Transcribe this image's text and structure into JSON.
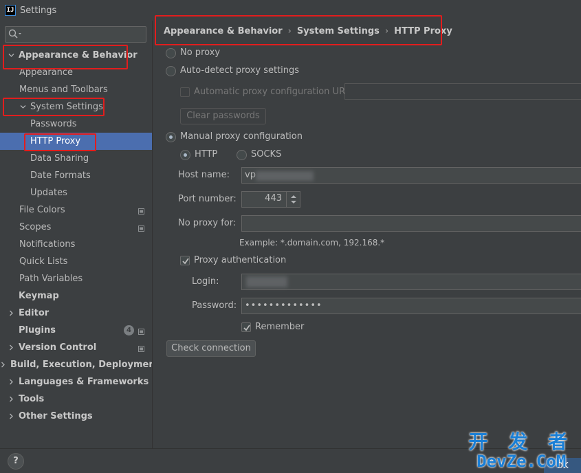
{
  "window": {
    "title": "Settings",
    "app_icon": "IJ"
  },
  "search": {
    "placeholder": "",
    "value": ""
  },
  "tree": {
    "items": [
      {
        "label": "Appearance & Behavior",
        "level": 0,
        "expanded": true,
        "bold": true
      },
      {
        "label": "Appearance",
        "level": 1
      },
      {
        "label": "Menus and Toolbars",
        "level": 1
      },
      {
        "label": "System Settings",
        "level": 1,
        "expanded": true
      },
      {
        "label": "Passwords",
        "level": 2
      },
      {
        "label": "HTTP Proxy",
        "level": 2,
        "selected": true
      },
      {
        "label": "Data Sharing",
        "level": 2
      },
      {
        "label": "Date Formats",
        "level": 2
      },
      {
        "label": "Updates",
        "level": 2
      },
      {
        "label": "File Colors",
        "level": 1,
        "settings_icon": true
      },
      {
        "label": "Scopes",
        "level": 1,
        "settings_icon": true
      },
      {
        "label": "Notifications",
        "level": 1
      },
      {
        "label": "Quick Lists",
        "level": 1
      },
      {
        "label": "Path Variables",
        "level": 1
      },
      {
        "label": "Keymap",
        "level": 0,
        "bold": true
      },
      {
        "label": "Editor",
        "level": 0,
        "collapsed": true,
        "bold": true
      },
      {
        "label": "Plugins",
        "level": 0,
        "bold": true,
        "badge": "4",
        "settings_icon": true
      },
      {
        "label": "Version Control",
        "level": 0,
        "collapsed": true,
        "bold": true,
        "settings_icon": true
      },
      {
        "label": "Build, Execution, Deployment",
        "level": 0,
        "collapsed": true,
        "bold": true
      },
      {
        "label": "Languages & Frameworks",
        "level": 0,
        "collapsed": true,
        "bold": true
      },
      {
        "label": "Tools",
        "level": 0,
        "collapsed": true,
        "bold": true
      },
      {
        "label": "Other Settings",
        "level": 0,
        "collapsed": true,
        "bold": true
      }
    ]
  },
  "breadcrumb": [
    "Appearance & Behavior",
    "System Settings",
    "HTTP Proxy"
  ],
  "proxy": {
    "no_proxy_label": "No proxy",
    "auto_detect_label": "Auto-detect proxy settings",
    "auto_config_url_label": "Automatic proxy configuration URL:",
    "auto_config_url_value": "",
    "clear_passwords_label": "Clear passwords",
    "manual_label": "Manual proxy configuration",
    "http_label": "HTTP",
    "socks_label": "SOCKS",
    "host_label": "Host name:",
    "host_value": "vp",
    "port_label": "Port number:",
    "port_value": "443",
    "no_proxy_for_label": "No proxy for:",
    "no_proxy_for_value": "",
    "example_text": "Example: *.domain.com, 192.168.*",
    "auth_label": "Proxy authentication",
    "login_label": "Login:",
    "login_value": "",
    "password_label": "Password:",
    "password_value": "•••••••••••••",
    "remember_label": "Remember",
    "check_connection_label": "Check connection",
    "selected_mode": "manual",
    "selected_protocol": "HTTP",
    "auth_checked": true,
    "remember_checked": true
  },
  "footer": {
    "help_label": "?",
    "ok_label": "OK"
  },
  "watermark": {
    "top": "开 发 者",
    "bottom": "DevZe.CoM"
  },
  "colors": {
    "selection": "#4b6eaf",
    "highlight_box": "#e21d1d",
    "background": "#3c3f41"
  }
}
